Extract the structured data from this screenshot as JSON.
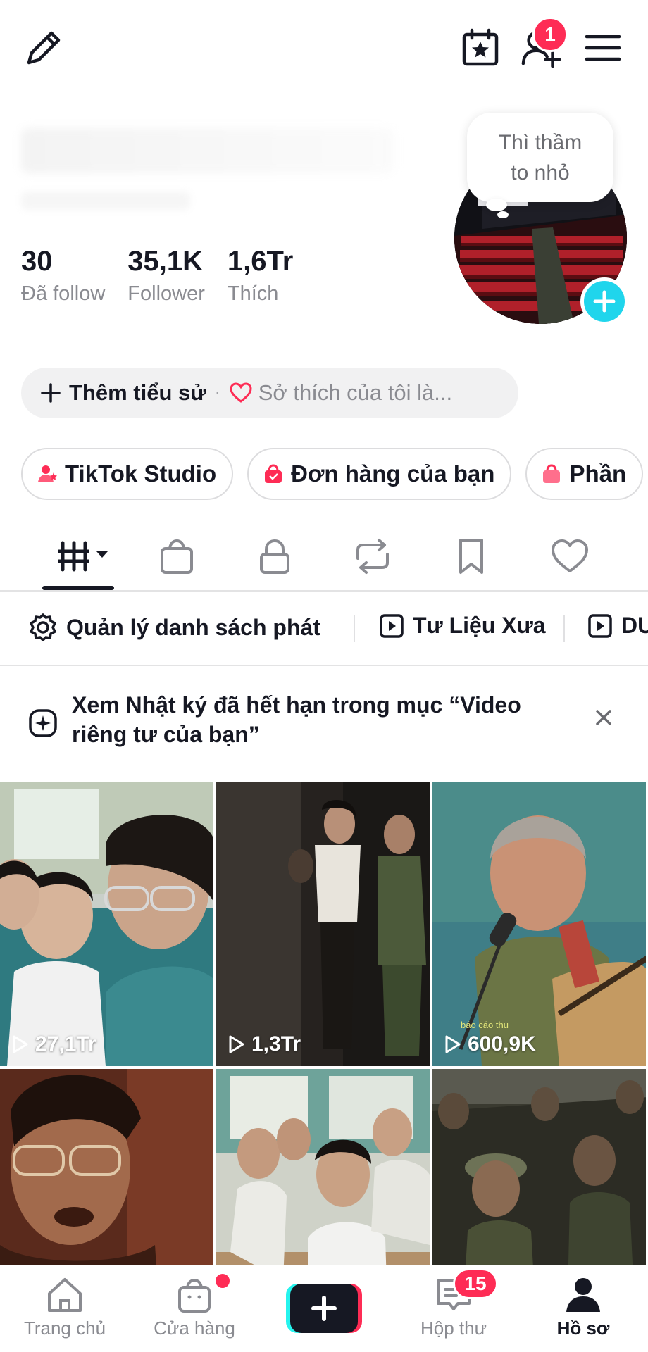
{
  "topbar": {
    "friend_badge": "1"
  },
  "profile": {
    "bubble_text": "Thì thầm to nhỏ",
    "stats": [
      {
        "value": "30",
        "label": "Đã follow"
      },
      {
        "value": "35,1K",
        "label": "Follower"
      },
      {
        "value": "1,6Tr",
        "label": "Thích"
      }
    ],
    "bio": {
      "add_label": "Thêm tiểu sử",
      "separator": "·",
      "hint": "Sở thích của tôi là..."
    }
  },
  "chips": [
    {
      "label": "TikTok Studio"
    },
    {
      "label": "Đơn hàng của bạn"
    },
    {
      "label": "Phần"
    }
  ],
  "playlists": {
    "manage_label": "Quản lý danh sách phát",
    "items": [
      "Tư Liệu Xưa",
      "DU"
    ]
  },
  "notice": {
    "text": "Xem Nhật ký đã hết hạn trong mục “Video riêng tư của bạn”"
  },
  "videos": [
    {
      "views": "27,1Tr"
    },
    {
      "views": "1,3Tr"
    },
    {
      "views": "600,9K",
      "caption": "báo cáo thu"
    },
    {
      "views": ""
    },
    {
      "views": ""
    },
    {
      "views": ""
    }
  ],
  "bottomnav": {
    "items": [
      {
        "label": "Trang chủ"
      },
      {
        "label": "Cửa hàng"
      },
      {
        "label": "Hộp thư",
        "badge": "15"
      },
      {
        "label": "Hồ sơ"
      }
    ]
  },
  "colors": {
    "accent": "#fe2c55",
    "cyan": "#20d5ec",
    "text": "#161823",
    "muted": "#8a8b91"
  }
}
